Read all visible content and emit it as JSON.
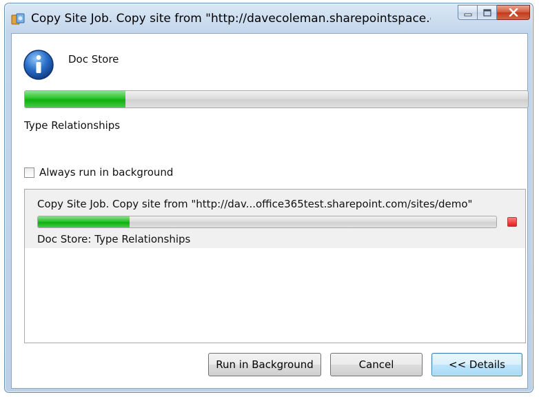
{
  "window": {
    "title": "Copy Site Job. Copy site from \"http://davecoleman.sharepointspace.co..."
  },
  "current_job": {
    "name": "Doc Store",
    "progress": 0.2,
    "step": "Type Relationships"
  },
  "options": {
    "always_background_label": "Always run in background",
    "always_background_checked": false
  },
  "jobs": [
    {
      "description": "Copy Site Job. Copy site from \"http://dav...office365test.sharepoint.com/sites/demo\"",
      "progress": 0.2,
      "status": "Doc Store: Type Relationships"
    }
  ],
  "buttons": {
    "run_background": "Run in Background",
    "cancel": "Cancel",
    "details": "<< Details"
  },
  "icons": {
    "app": "copy-site-app-icon",
    "info": "info-icon",
    "minimize": "minimize-icon",
    "maximize": "maximize-icon",
    "close": "close-icon",
    "stop": "stop-icon"
  },
  "colors": {
    "progress_fill": "#1db81d",
    "stop": "#e01e1e",
    "close_button": "#c0391a",
    "info_icon": "#2a6fc9"
  }
}
